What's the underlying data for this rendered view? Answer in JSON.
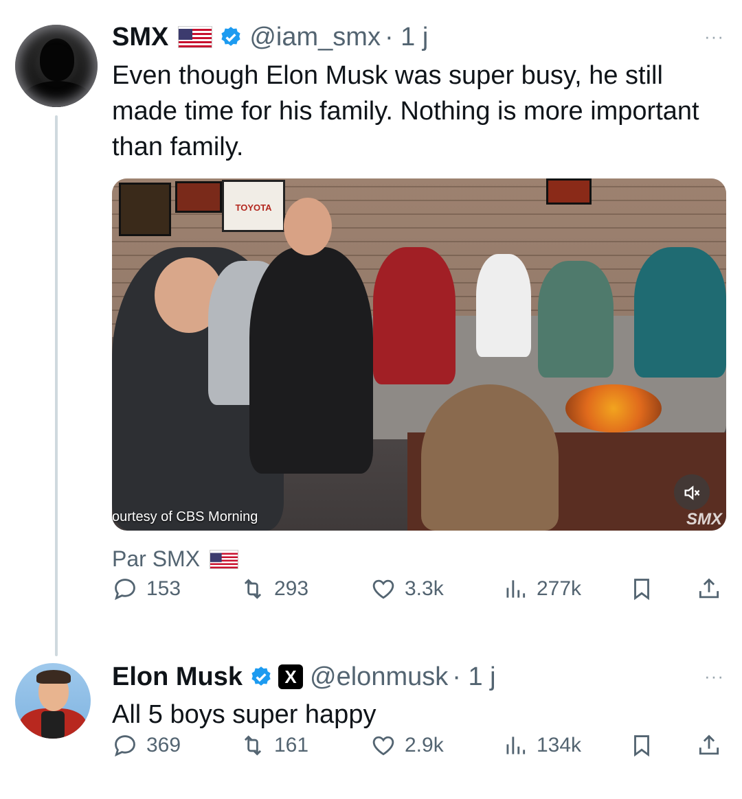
{
  "tweet1": {
    "name": "SMX",
    "flag_icon": "us-flag-icon",
    "handle": "@iam_smx",
    "time": "· 1 j",
    "more": "···",
    "text": "Even though Elon Musk was super busy, he still made time for his family. Nothing is more important than family.",
    "media": {
      "caption": "ourtesy of CBS Morning",
      "watermark": "SMX",
      "sign_text": "TOYOTA",
      "mute_icon": "speaker-muted-icon"
    },
    "attribution": "Par SMX",
    "stats": {
      "replies": "153",
      "reposts": "293",
      "likes": "3.3k",
      "views": "277k"
    }
  },
  "tweet2": {
    "name": "Elon Musk",
    "handle": "@elonmusk",
    "time": "· 1 j",
    "more": "···",
    "badge": "X",
    "text": "All 5 boys super happy",
    "stats": {
      "replies": "369",
      "reposts": "161",
      "likes": "2.9k",
      "views": "134k"
    }
  },
  "colors": {
    "verified": "#1d9bf0",
    "muted_text": "#536471",
    "thread_line": "#cfd9de"
  }
}
